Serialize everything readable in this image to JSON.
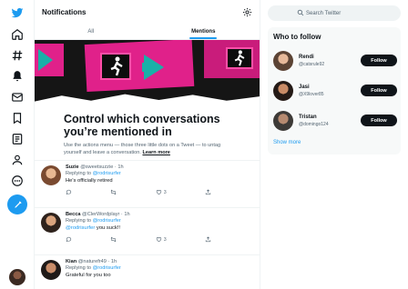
{
  "colors": {
    "accent": "#1d9bf0",
    "text": "#0f1419",
    "muted": "#536471",
    "brand_pink": "#e0218a"
  },
  "nav": {
    "items": [
      "twitter-logo-icon",
      "home-icon",
      "explore-icon",
      "notifications-icon",
      "messages-icon",
      "bookmarks-icon",
      "lists-icon",
      "profile-icon",
      "more-icon"
    ],
    "compose": "compose-icon"
  },
  "header": {
    "title": "Notifications",
    "settings_icon": "gear-icon"
  },
  "tabs": [
    {
      "label": "All"
    },
    {
      "label": "Mentions"
    }
  ],
  "promo": {
    "title": "Control which conversations you’re mentioned in",
    "body": "Use the actions menu — those three little dots on a Tweet — to untag yourself and leave a conversation.",
    "link": "Learn more"
  },
  "notifications": [
    {
      "name": "Suzie",
      "handle": "@sweetsuzzie",
      "time": "1h",
      "replying": "Replying to",
      "mention": "@rodrisurfer",
      "text": "He's officially retired",
      "mention_in_text": "",
      "likes": "3"
    },
    {
      "name": "Becca",
      "handle": "@ClerWordplayr",
      "time": "1h",
      "replying": "Replying to",
      "mention": "@rodrisurfer",
      "text": " you suck!!",
      "mention_in_text": "@rodrisurfer",
      "likes": "3"
    },
    {
      "name": "Kian",
      "handle": "@naturefr49",
      "time": "1h",
      "replying": "Replying to",
      "mention": "@rodrisurfer",
      "text": "Grateful for you too",
      "mention_in_text": "",
      "likes": ""
    }
  ],
  "search": {
    "placeholder": "Search Twitter"
  },
  "who_to_follow": {
    "title": "Who to follow",
    "users": [
      {
        "name": "Rendi",
        "handle": "@catsrule92",
        "button": "Follow"
      },
      {
        "name": "Jasi",
        "handle": "@X9lover85",
        "button": "Follow"
      },
      {
        "name": "Tristan",
        "handle": "@domingo124",
        "button": "Follow"
      }
    ],
    "show_more": "Show more"
  }
}
